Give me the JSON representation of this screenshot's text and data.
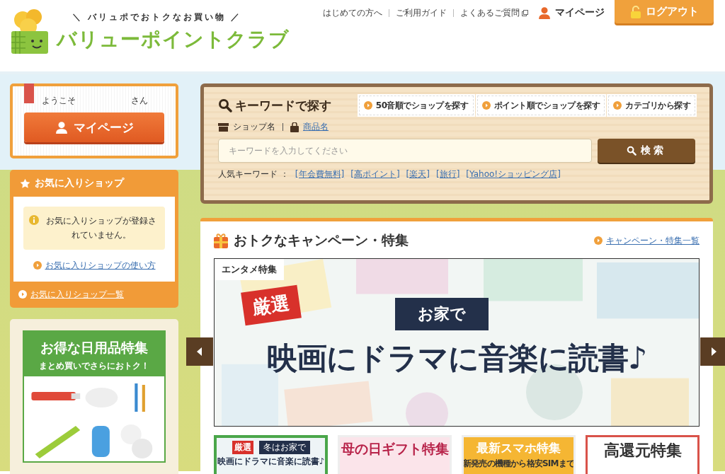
{
  "header": {
    "tagline": "＼ バリュポでおトクなお買い物 ／",
    "site_name": "バリューポイントクラブ",
    "nav": [
      {
        "label": "はじめての方へ",
        "external": false
      },
      {
        "label": "ご利用ガイド",
        "external": false
      },
      {
        "label": "よくあるご質問",
        "external": true
      }
    ],
    "mypage_link": "マイページ",
    "logout_button": "ログアウト"
  },
  "welcome": {
    "greeting": "ようこそ",
    "suffix": "さん",
    "button": "マイページ"
  },
  "favorites": {
    "title": "お気に入りショップ",
    "notice": "お気に入りショップが登録されていません。",
    "help_link": "お気に入りショップの使い方",
    "list_link": "お気に入りショップ一覧"
  },
  "side_banner": {
    "title": "お得な日用品特集",
    "subtitle": "まとめ買いでさらにおトク！"
  },
  "search": {
    "title": "キーワードで探す",
    "shortcuts": [
      "50音順でショップを探す",
      "ポイント順でショップを探す",
      "カテゴリから探す"
    ],
    "modes": [
      {
        "label": "ショップ名",
        "kind": "shop",
        "selected": true
      },
      {
        "label": "商品名",
        "kind": "product",
        "selected": false
      }
    ],
    "placeholder": "キーワードを入力してください",
    "button": "検索",
    "popular_label": "人気キーワード ：",
    "popular": [
      "[年会費無料]",
      "[高ポイント]",
      "[楽天]",
      "[旅行]",
      "[Yahoo!ショッピング店]"
    ]
  },
  "campaign": {
    "title": "おトクなキャンペーン・特集",
    "all_link": "キャンペーン・特集一覧",
    "slide": {
      "category": "エンタメ特集",
      "tag": "厳選",
      "house": "お家で",
      "headline": "映画にドラマに音楽に読書♪"
    },
    "thumbnails": [
      {
        "kind": "entame",
        "selected": true,
        "tag": "厳選",
        "house": "冬はお家で",
        "title": "映画にドラマに音楽に読書♪"
      },
      {
        "kind": "gift",
        "selected": false,
        "title": "母の日ギフト特集"
      },
      {
        "kind": "phone",
        "selected": false,
        "title": "最新スマホ特集",
        "subtitle": "新発売の機種から格安SIMまで"
      },
      {
        "kind": "rebate",
        "selected": false,
        "title": "高還元特集"
      }
    ]
  }
}
